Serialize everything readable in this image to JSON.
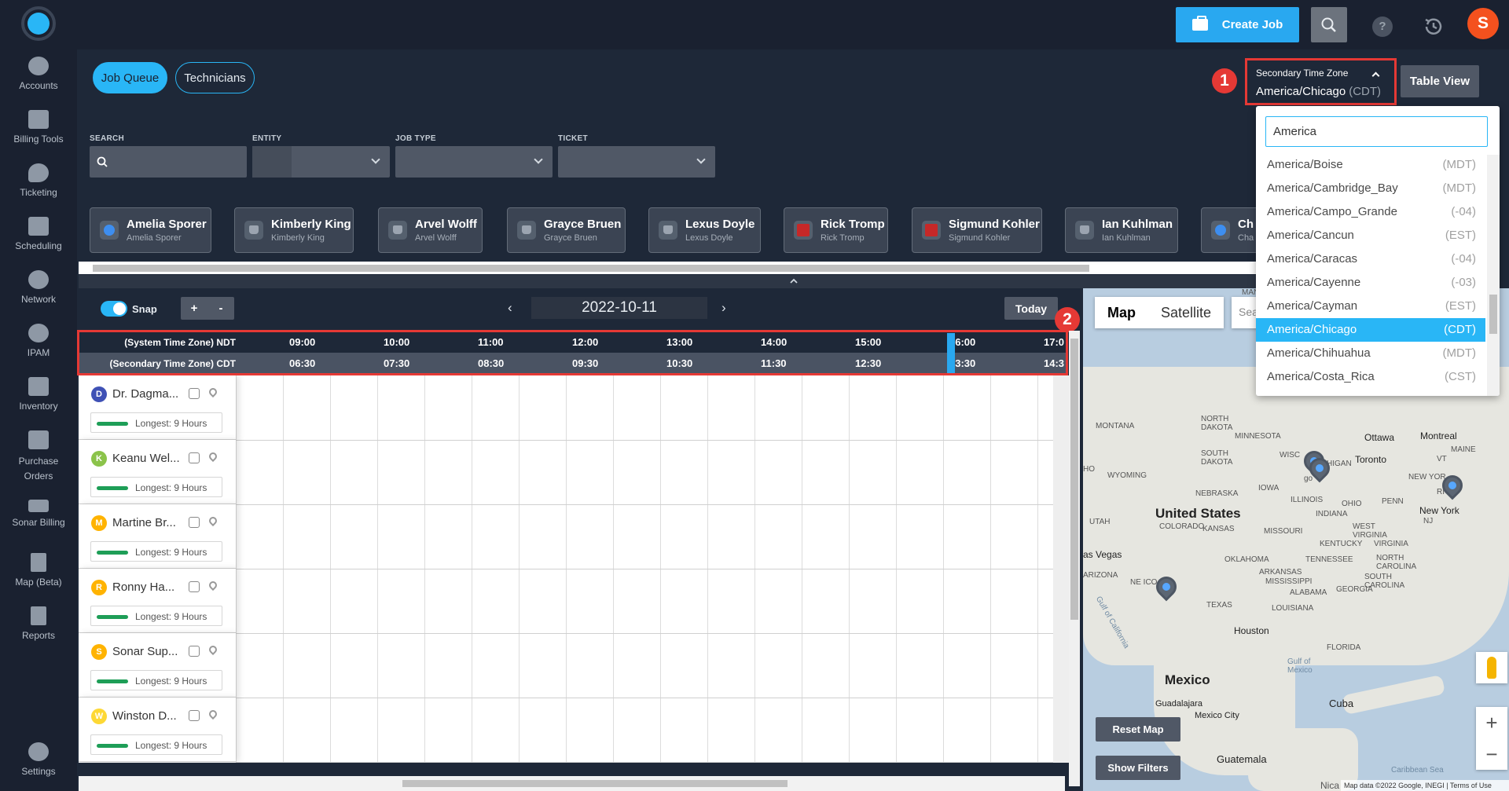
{
  "header": {
    "create_job_label": "Create Job",
    "help_label": "?",
    "avatar_letter": "S"
  },
  "sidebar": {
    "items": [
      {
        "label": "Accounts",
        "icon": "accounts-icon"
      },
      {
        "label": "Billing Tools",
        "icon": "abacus-icon"
      },
      {
        "label": "Ticketing",
        "icon": "chat-bubble-icon"
      },
      {
        "label": "Scheduling",
        "icon": "calendar-icon"
      },
      {
        "label": "Network",
        "icon": "network-icon"
      },
      {
        "label": "IPAM",
        "icon": "ipam-icon"
      },
      {
        "label": "Inventory",
        "icon": "cart-icon"
      },
      {
        "label": "Purchase Orders",
        "icon": "purchase-order-icon"
      },
      {
        "label": "Sonar Billing",
        "icon": "billing-card-icon"
      },
      {
        "label": "Map (Beta)",
        "icon": "map-icon"
      },
      {
        "label": "Reports",
        "icon": "report-icon"
      },
      {
        "label": "Settings",
        "icon": "gear-icon"
      }
    ]
  },
  "tabs": {
    "job_queue": "Job Queue",
    "technicians": "Technicians"
  },
  "filters": {
    "search_label": "SEARCH",
    "entity_label": "ENTITY",
    "job_type_label": "JOB TYPE",
    "ticket_label": "TICKET"
  },
  "secondary_tz": {
    "label": "Secondary Time Zone",
    "value": "America/Chicago",
    "abbr": "(CDT)",
    "search_value": "America",
    "options": [
      {
        "name": "America/Boise",
        "abbr": "(MDT)"
      },
      {
        "name": "America/Cambridge_Bay",
        "abbr": "(MDT)"
      },
      {
        "name": "America/Campo_Grande",
        "abbr": "(-04)"
      },
      {
        "name": "America/Cancun",
        "abbr": "(EST)"
      },
      {
        "name": "America/Caracas",
        "abbr": "(-04)"
      },
      {
        "name": "America/Cayenne",
        "abbr": "(-03)"
      },
      {
        "name": "America/Cayman",
        "abbr": "(EST)"
      },
      {
        "name": "America/Chicago",
        "abbr": "(CDT)"
      },
      {
        "name": "America/Chihuahua",
        "abbr": "(MDT)"
      },
      {
        "name": "America/Costa_Rica",
        "abbr": "(CST)"
      }
    ],
    "selected_option": "America/Chicago"
  },
  "table_view_label": "Table View",
  "callouts": {
    "one": "1",
    "two": "2"
  },
  "tech_cards": [
    {
      "name": "Amelia Sporer",
      "sub": "Amelia Sporer",
      "status": "blue"
    },
    {
      "name": "Kimberly King",
      "sub": "Kimberly King",
      "status": "gray"
    },
    {
      "name": "Arvel Wolff",
      "sub": "Arvel Wolff",
      "status": "gray"
    },
    {
      "name": "Grayce Bruen",
      "sub": "Grayce Bruen",
      "status": "gray"
    },
    {
      "name": "Lexus Doyle",
      "sub": "Lexus Doyle",
      "status": "gray"
    },
    {
      "name": "Rick Tromp",
      "sub": "Rick Tromp",
      "status": "red"
    },
    {
      "name": "Sigmund Kohler",
      "sub": "Sigmund Kohler",
      "status": "red"
    },
    {
      "name": "Ian Kuhlman",
      "sub": "Ian Kuhlman",
      "status": "gray"
    },
    {
      "name": "Ch",
      "sub": "Cha",
      "status": "blue"
    }
  ],
  "timeline": {
    "snap_label": "Snap",
    "zoom_in": "+",
    "zoom_out": "-",
    "date": "2022-10-11",
    "prev": "‹",
    "next": "›",
    "today_label": "Today",
    "system_tz_label": "(System Time Zone) NDT",
    "secondary_tz_label": "(Secondary Time Zone) CDT",
    "system_times": [
      "09:00",
      "10:00",
      "11:00",
      "12:00",
      "13:00",
      "14:00",
      "15:00",
      "16:00",
      "17:0"
    ],
    "secondary_times": [
      "06:30",
      "07:30",
      "08:30",
      "09:30",
      "10:30",
      "11:30",
      "12:30",
      "13:30",
      "14:3"
    ]
  },
  "technician_rows": [
    {
      "initial": "D",
      "name": "Dr. Dagma...",
      "longest": "Longest: 9 Hours",
      "color": "#3f51b5"
    },
    {
      "initial": "K",
      "name": "Keanu Wel...",
      "longest": "Longest: 9 Hours",
      "color": "#8bc34a"
    },
    {
      "initial": "M",
      "name": "Martine Br...",
      "longest": "Longest: 9 Hours",
      "color": "#ffb300"
    },
    {
      "initial": "R",
      "name": "Ronny Ha...",
      "longest": "Longest: 9 Hours",
      "color": "#ffb300"
    },
    {
      "initial": "S",
      "name": "Sonar Sup...",
      "longest": "Longest: 9 Hours",
      "color": "#ffb300"
    },
    {
      "initial": "W",
      "name": "Winston D...",
      "longest": "Longest: 9 Hours",
      "color": "#fdd835"
    }
  ],
  "map": {
    "tab_map": "Map",
    "tab_satellite": "Satellite",
    "search_stub": "Sea",
    "reset_label": "Reset Map",
    "filters_label": "Show Filters",
    "labels": {
      "united_states": "United States",
      "mexico": "Mexico",
      "cuba": "Cuba",
      "guatemala": "Guatemala",
      "houston": "Houston",
      "new_york": "New York",
      "toronto": "Toronto",
      "ottawa": "Ottawa",
      "montreal": "Montreal",
      "las_vegas": "as Vegas",
      "guadalajara": "Guadalajara",
      "mexico_city": "Mexico City",
      "montana": "MONTANA",
      "wyoming": "WYOMING",
      "colorado": "COLORADO",
      "kansas": "KANSAS",
      "missouri": "MISSOURI",
      "illinois": "ILLINOIS",
      "iowa": "IOWA",
      "nebraska": "NEBRASKA",
      "texas": "TEXAS",
      "oklahoma": "OKLAHOMA",
      "arkansas": "ARKANSAS",
      "ohio": "OHIO",
      "indiana": "INDIANA",
      "kentucky": "KENTUCKY",
      "tennessee": "TENNESSEE",
      "arizona": "ARIZONA",
      "utah": "UTAH",
      "mississippi": "MISSISSIPPI",
      "alabama": "ALABAMA",
      "florida": "FLORIDA",
      "north_dakota": "NORTH DAKOTA",
      "south_dakota": "SOUTH DAKOTA",
      "minnesota": "MINNESOTA",
      "maine": "MAINE",
      "penn": "PENN",
      "west_virginia": "WEST VIRGINIA",
      "virginia": "VIRGINIA",
      "north_carolina": "NORTH CAROLINA",
      "south_carolina": "SOUTH CAROLINA",
      "georgia": "GEORGIA",
      "louisiana": "LOUISIANA",
      "gulf_of_mexico": "Gulf of Mexico",
      "gulf_of_california": "Gulf of California",
      "caribbean": "Caribbean Sea",
      "manitoba": "MANITOBA",
      "idaho": "HO",
      "mexico_state": "NE   ICO",
      "wisc": "WISC",
      "michigan": "ICHIGAN",
      "chicago": "go",
      "new_york_state": "NEW YOR",
      "nj": "NJ",
      "vt": "VT",
      "ri": "RI",
      "nica": "Nica"
    },
    "footer": "Map data ©2022 Google, INEGI | Terms of Use",
    "zoom_in": "+",
    "zoom_out": "−"
  }
}
